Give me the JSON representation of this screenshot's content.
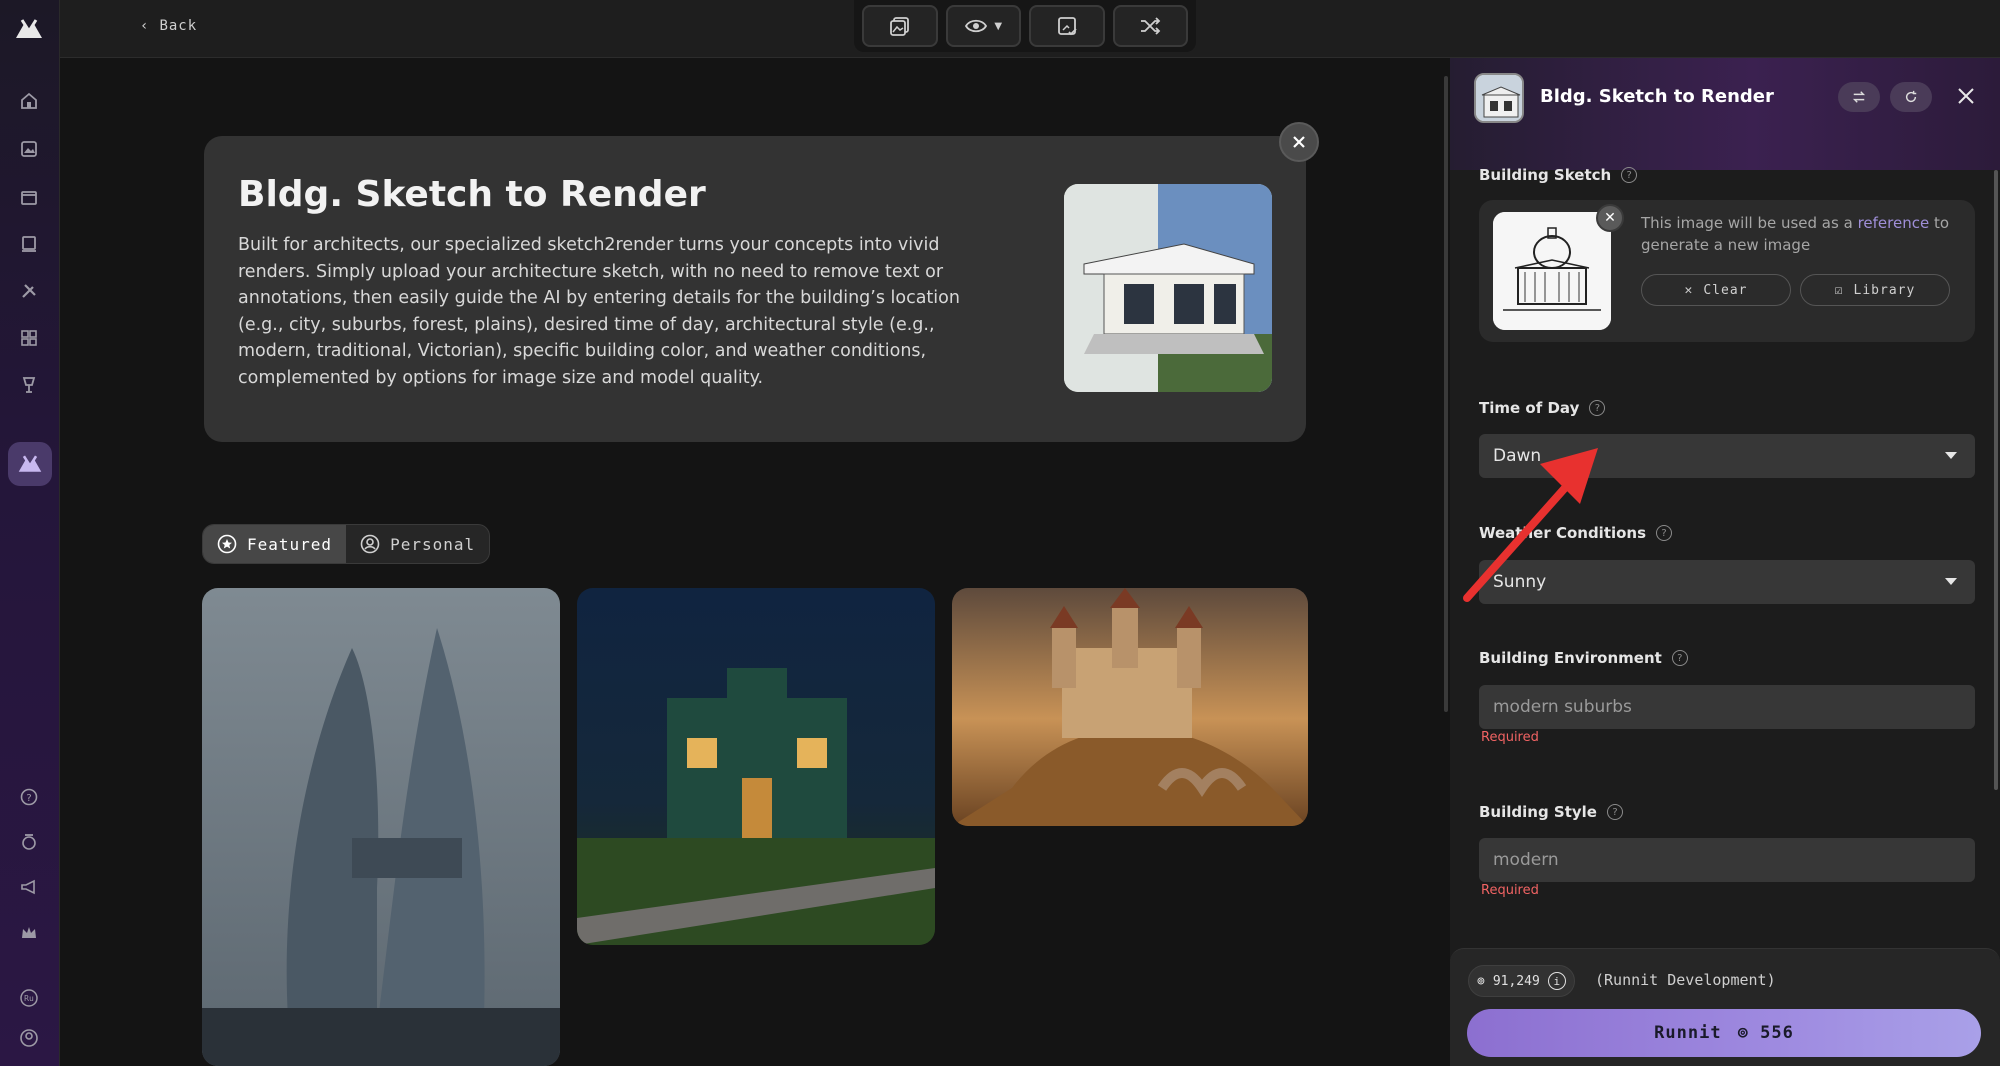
{
  "topbar": {
    "back_label": "Back",
    "tools": [
      "image-gallery-icon",
      "eye-icon",
      "image-check-icon",
      "shuffle-icon"
    ]
  },
  "sidebar": {
    "items": [
      "home-icon",
      "images-icon",
      "video-icon",
      "screen-icon",
      "tools-icon",
      "grid-icon",
      "trophy-icon",
      "runnit-icon"
    ],
    "bottom_items": [
      "help-icon",
      "award-icon",
      "megaphone-icon",
      "crown-icon",
      "user-initials-icon",
      "profile-icon"
    ],
    "avatar_initials": "Ru"
  },
  "hero": {
    "title": "Bldg. Sketch to Render",
    "description": "Built for architects, our specialized sketch2render turns your concepts into vivid renders. Simply upload your architecture sketch, with no need to remove text or annotations, then easily guide the AI by entering details for the building’s location (e.g., city, suburbs, forest, plains), desired time of day, architectural style (e.g., modern, traditional, Victorian), specific building color, and weather conditions, complemented by options for image size and model quality."
  },
  "gallery": {
    "tabs": [
      {
        "label": "Featured",
        "active": true
      },
      {
        "label": "Personal",
        "active": false
      }
    ]
  },
  "panel": {
    "title": "Bldg. Sketch to Render",
    "building_sketch": {
      "label": "Building Sketch",
      "help": "?",
      "text_before": "This image will be used as a",
      "link": "reference",
      "text_after": "to generate a new image",
      "clear_label": "Clear",
      "library_label": "Library"
    },
    "time_of_day": {
      "label": "Time of Day",
      "value": "Dawn"
    },
    "weather": {
      "label": "Weather Conditions",
      "value": "Sunny"
    },
    "environment": {
      "label": "Building Environment",
      "placeholder": "modern suburbs",
      "required": "Required"
    },
    "style": {
      "label": "Building Style",
      "placeholder": "modern",
      "required": "Required"
    }
  },
  "footer": {
    "credits": "91,249",
    "env": "(Runnit Development)",
    "run_label": "Runnit",
    "run_cost": "556"
  },
  "colors": {
    "accent": "#9e8ae0",
    "required": "#f06363",
    "link": "#9f8fd8",
    "arrow": "#e8312f"
  }
}
